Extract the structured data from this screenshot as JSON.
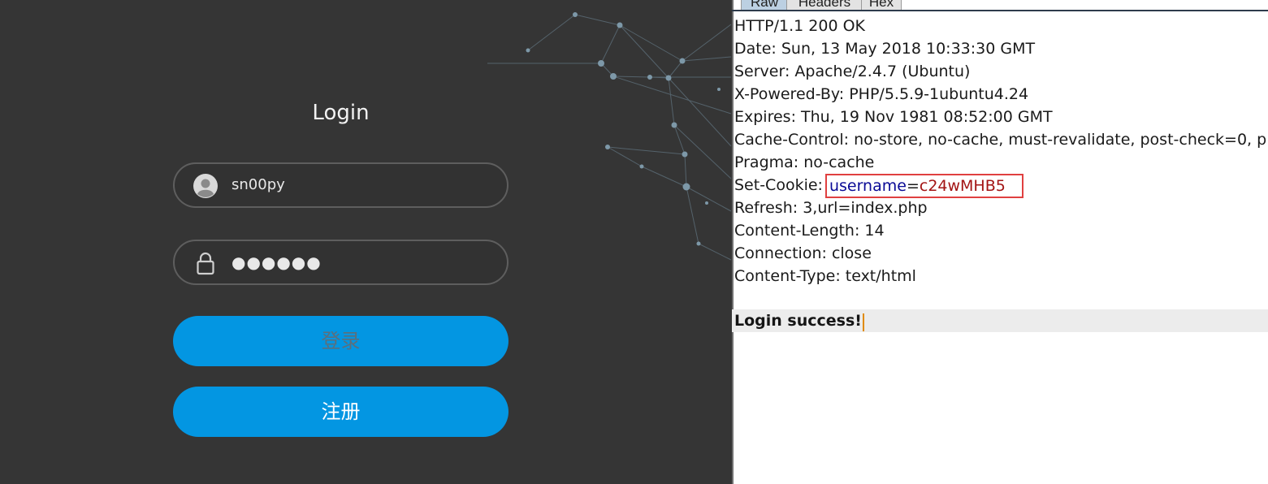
{
  "login": {
    "title": "Login",
    "username_value": "sn00py",
    "password_mask": "●●●●●●",
    "login_button": "登录",
    "register_button": "注册"
  },
  "response": {
    "tabs": [
      "Raw",
      "Headers",
      "Hex"
    ],
    "selected_tab": "Raw",
    "lines": [
      "HTTP/1.1 200 OK",
      "Date: Sun, 13 May 2018 10:33:30 GMT",
      "Server: Apache/2.4.7 (Ubuntu)",
      "X-Powered-By: PHP/5.5.9-1ubuntu4.24",
      "Expires: Thu, 19 Nov 1981 08:52:00 GMT",
      "Cache-Control: no-store, no-cache, must-revalidate, post-check=0, p",
      "Pragma: no-cache"
    ],
    "set_cookie": {
      "header": "Set-Cookie:",
      "name": "username",
      "equals": "=",
      "value": "c24wMHB5"
    },
    "lines_after": [
      "Refresh: 3,url=index.php",
      "Content-Length: 14",
      "Connection: close",
      "Content-Type: text/html"
    ],
    "body": "Login success!"
  },
  "colors": {
    "panel_bg": "#353535",
    "button_blue": "#0396e2",
    "highlight_red": "#e04040",
    "cookie_name": "#0a0a96",
    "cookie_value": "#a31414",
    "caret": "#e08a00"
  },
  "icons": {
    "username": "user-avatar-icon",
    "password": "padlock-icon"
  }
}
